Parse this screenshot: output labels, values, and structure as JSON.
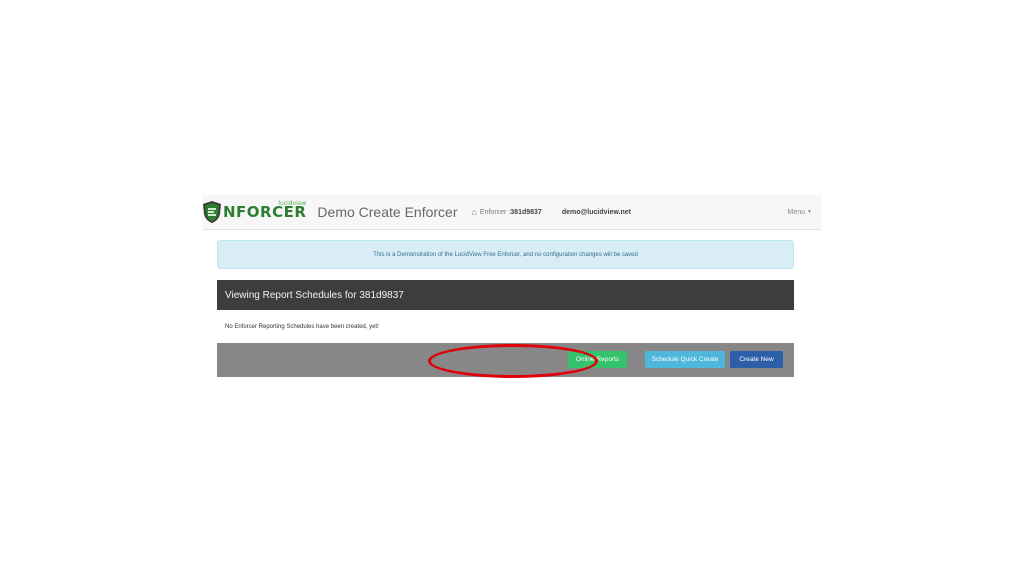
{
  "navbar": {
    "logo_text": "NFORCER",
    "logo_subtext": "lucidview",
    "brand": "Demo Create Enforcer",
    "enforcer_label": "Enforcer :",
    "enforcer_id": "381d9837",
    "user_email": "demo@lucidview.net",
    "menu_label": "Menu"
  },
  "alert": {
    "message": "This is a Demonstration of the LucidView Free Enforcer, and no configuration changes will be saved"
  },
  "panel": {
    "title": "Viewing Report Schedules for 381d9837",
    "empty_message": "No Enforcer Reporting Schedules have been created, yet!",
    "buttons": {
      "online_reports": "Online Reports",
      "schedule_quick_create": "Schedule Quick Create",
      "create_new": "Create New"
    }
  },
  "colors": {
    "highlight": "#e0000b",
    "online_reports_bg": "#35c26c",
    "schedule_quick_create_bg": "#4fb6dc",
    "create_new_bg": "#2c5fa8",
    "panel_header_bg": "#3d3d3d",
    "alert_bg": "#d9edf7"
  },
  "icons": {
    "logo": "shield-icon",
    "home": "home-icon",
    "menu_caret": "caret-down-icon"
  }
}
